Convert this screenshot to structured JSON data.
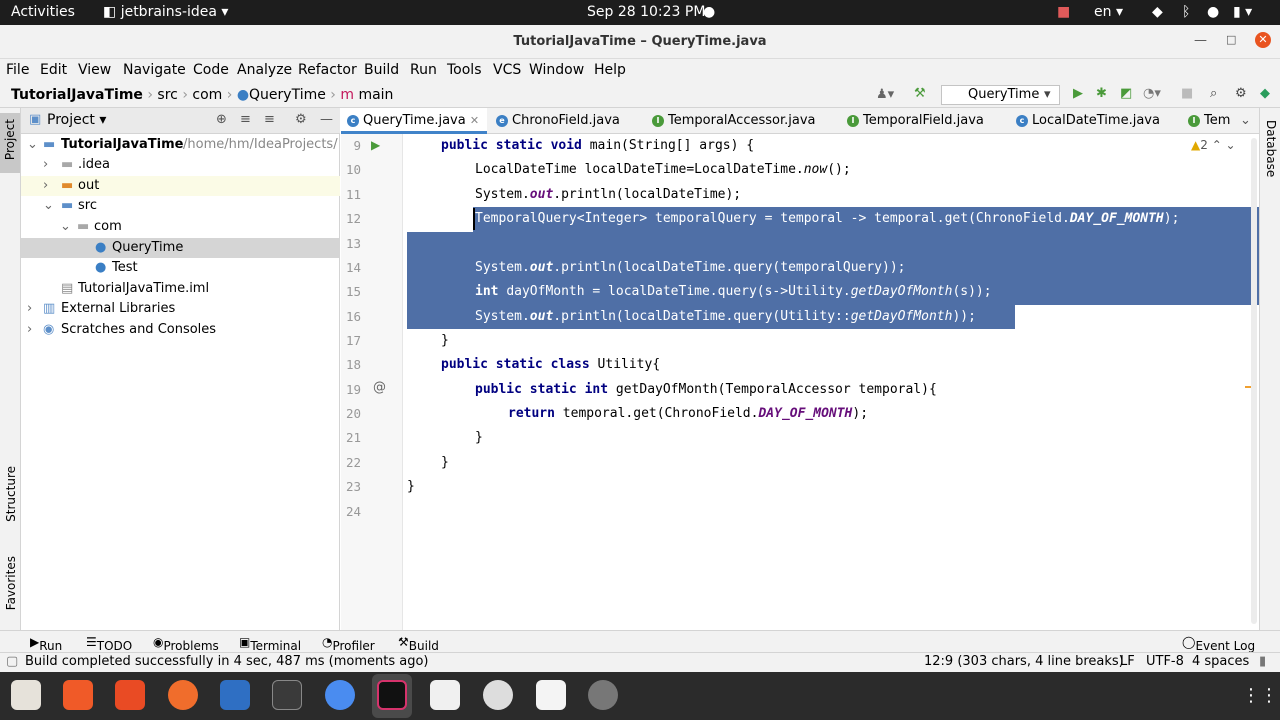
{
  "topbar": {
    "activities": "Activities",
    "app": "jetbrains-idea",
    "clock": "Sep 28  10:23 PM",
    "lang": "en"
  },
  "window": {
    "title": "TutorialJavaTime – QueryTime.java"
  },
  "menu": [
    "File",
    "Edit",
    "View",
    "Navigate",
    "Code",
    "Analyze",
    "Refactor",
    "Build",
    "Run",
    "Tools",
    "VCS",
    "Window",
    "Help"
  ],
  "breadcrumb": {
    "project": "TutorialJavaTime",
    "src": "src",
    "com": "com",
    "class": "QueryTime",
    "method": "main"
  },
  "run_config": "QueryTime",
  "project_panel": {
    "title": "Project",
    "root": "TutorialJavaTime",
    "root_path": "/home/hm/IdeaProjects/",
    "idea": ".idea",
    "out": "out",
    "src": "src",
    "com": "com",
    "query": "QueryTime",
    "test": "Test",
    "iml": "TutorialJavaTime.iml",
    "libs": "External Libraries",
    "scratches": "Scratches and Consoles"
  },
  "tabs": [
    "QueryTime.java",
    "ChronoField.java",
    "TemporalAccessor.java",
    "TemporalField.java",
    "LocalDateTime.java",
    "Tem"
  ],
  "warnings": "2",
  "line_numbers": [
    "9",
    "10",
    "11",
    "12",
    "13",
    "14",
    "15",
    "16",
    "17",
    "18",
    "19",
    "20",
    "21",
    "22",
    "23",
    "24"
  ],
  "code": {
    "l9a": "public static void ",
    "l9b": "main(String[] args) {",
    "l10a": "LocalDateTime localDateTime=LocalDateTime.",
    "l10b": "now",
    "l10c": "();",
    "l11a": "System.",
    "l11b": "out",
    "l11c": ".println(localDateTime);",
    "l12a": "TemporalQuery<Integer> temporalQuery = temporal -> temporal.get(ChronoField.",
    "l12b": "DAY_OF_MONTH",
    "l12c": ");",
    "l14a": "System.",
    "l14b": "out",
    "l14c": ".println(localDateTime.query(temporalQuery));",
    "l15a": "int ",
    "l15b": "dayOfMonth = localDateTime.query(s->Utility.",
    "l15c": "getDayOfMonth",
    "l15d": "(s));",
    "l16a": "System.",
    "l16b": "out",
    "l16c": ".println(localDateTime.query(Utility::",
    "l16d": "getDayOfMonth",
    "l16e": "));",
    "l17": "}",
    "l18a": "public static class ",
    "l18b": "Utility{",
    "l19a": "public static int ",
    "l19b": "getDayOfMonth(TemporalAccessor temporal){",
    "l20a": "return ",
    "l20b": "temporal.get(ChronoField.",
    "l20c": "DAY_OF_MONTH",
    "l20d": ");",
    "l21": "}",
    "l22": "}",
    "l23": "}"
  },
  "side_labels": {
    "project": "Project",
    "structure": "Structure",
    "favorites": "Favorites",
    "database": "Database"
  },
  "bottom_tabs": [
    "Run",
    "TODO",
    "Problems",
    "Terminal",
    "Profiler",
    "Build"
  ],
  "event_log": "Event Log",
  "status": {
    "message": "Build completed successfully in 4 sec, 487 ms (moments ago)",
    "position": "12:9 (303 chars, 4 line breaks)",
    "lf": "LF",
    "enc": "UTF-8",
    "indent": "4 spaces"
  },
  "colors": {
    "selection": "#4f6fa6",
    "keyword": "#000080",
    "field": "#660e7a",
    "java_class": "#3b7fc4"
  }
}
